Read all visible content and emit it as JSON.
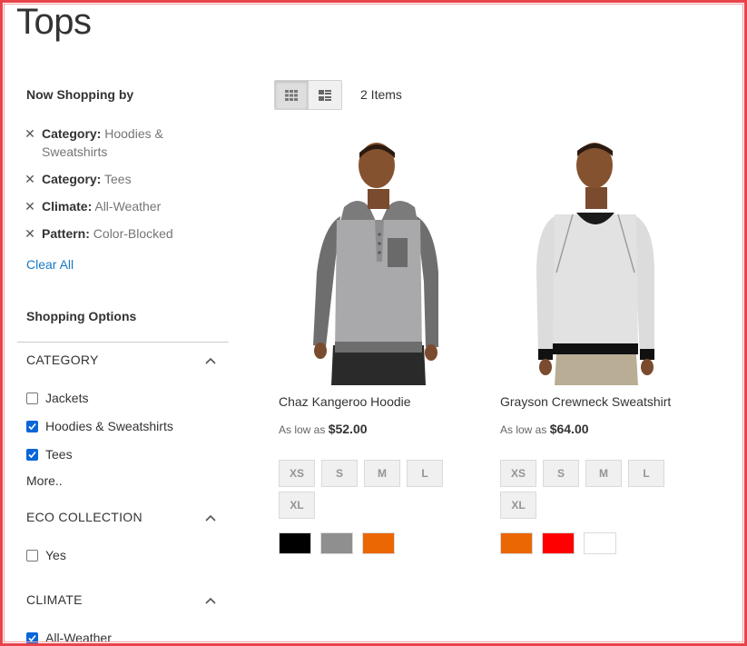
{
  "page": {
    "title": "Tops"
  },
  "now_shopping": {
    "title": "Now Shopping by",
    "filters": [
      {
        "label": "Category:",
        "value": "Hoodies & Sweatshirts"
      },
      {
        "label": "Category:",
        "value": "Tees"
      },
      {
        "label": "Climate:",
        "value": "All-Weather"
      },
      {
        "label": "Pattern:",
        "value": "Color-Blocked"
      }
    ],
    "clear_all": "Clear All"
  },
  "shopping_options": {
    "title": "Shopping Options",
    "sections": [
      {
        "title": "CATEGORY",
        "options": [
          {
            "label": "Jackets",
            "checked": false
          },
          {
            "label": "Hoodies & Sweatshirts",
            "checked": true
          },
          {
            "label": "Tees",
            "checked": true
          }
        ],
        "more": "More.."
      },
      {
        "title": "ECO COLLECTION",
        "options": [
          {
            "label": "Yes",
            "checked": false
          }
        ]
      },
      {
        "title": "CLIMATE",
        "options": [
          {
            "label": "All-Weather",
            "checked": true
          }
        ]
      }
    ]
  },
  "toolbar": {
    "items_count": "2 Items",
    "mode_grid": "grid-icon",
    "mode_list": "list-icon"
  },
  "products": [
    {
      "name": "Chaz Kangeroo Hoodie",
      "price_prefix": "As low as",
      "price": "$52.00",
      "sizes": [
        "XS",
        "S",
        "M",
        "L",
        "XL"
      ],
      "colors": [
        "#000000",
        "#8f8f8f",
        "#eb6703"
      ]
    },
    {
      "name": "Grayson Crewneck Sweatshirt",
      "price_prefix": "As low as",
      "price": "$64.00",
      "sizes": [
        "XS",
        "S",
        "M",
        "L",
        "XL"
      ],
      "colors": [
        "#eb6703",
        "#ff0000",
        "#ffffff"
      ]
    }
  ]
}
